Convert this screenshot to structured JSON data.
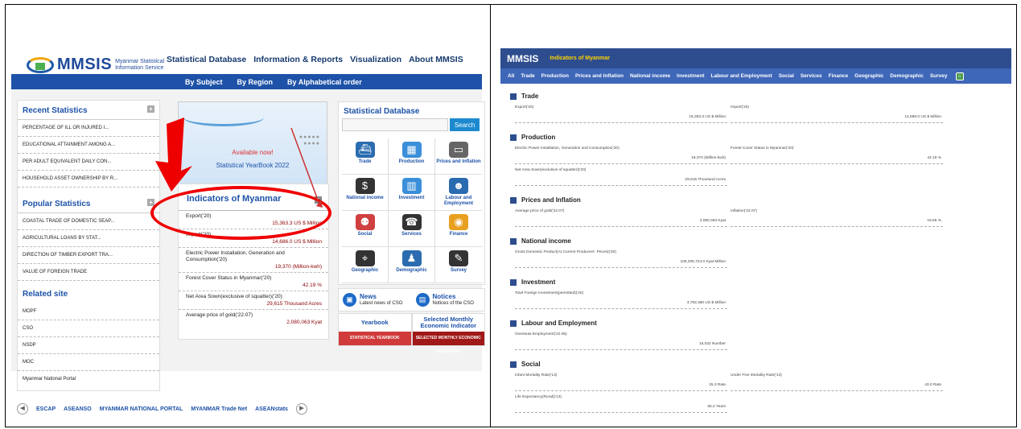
{
  "left": {
    "logo": {
      "name": "MMSIS",
      "sub": "Myanmar Statistical Information Service"
    },
    "topnav": [
      "Statistical Database",
      "Information & Reports",
      "Visualization",
      "About MMSIS"
    ],
    "subnav": [
      "By Subject",
      "By Region",
      "By Alphabetical order"
    ],
    "recent": {
      "title": "Recent Statistics",
      "items": [
        "PERCENTAGE OF ILL OR INJURED I...",
        "EDUCATIONAL ATTAINMENT AMONG A...",
        "PER ADULT EQUIVALENT DAILY CON...",
        "HOUSEHOLD ASSET OWNERSHIP BY R..."
      ]
    },
    "popular": {
      "title": "Popular Statistics",
      "items": [
        "COASTAL TRADE OF DOMESTIC SEAP...",
        "AGRICULTURAL LOANS BY STAT...",
        "DIRECTION OF TIMBER EXPORT TRA...",
        "VALUE OF FOREIGN TRADE"
      ]
    },
    "related": {
      "title": "Related site",
      "items": [
        "MOPF",
        "CSO",
        "NSDP",
        "MOC",
        "Myanmar National Portal"
      ]
    },
    "banner": {
      "available": "Available now!",
      "yearbook": "Statistical YearBook 2022"
    },
    "indicators": {
      "title": "Indicators of Myanmar",
      "rows": [
        {
          "label": "Export('20)",
          "value": "15,363.3 US $ Million"
        },
        {
          "label": "Import('20)",
          "value": "14,686.0 US $ Million"
        },
        {
          "label": "Electric Power Installation, Generation and Consumption('20)",
          "value": "19,370 (Million-kwh)"
        },
        {
          "label": "Forest Cover Status in Myanmar('20)",
          "value": "42.19 %"
        },
        {
          "label": "Net Area Sown(exclusive of squatter)('20)",
          "value": "29,615 Thousand Acres"
        },
        {
          "label": "Average price of gold('22.07)",
          "value": "2,080,063 Kyat"
        }
      ]
    },
    "statdb": {
      "title": "Statistical Database",
      "search_button": "Search",
      "categories": [
        {
          "label": "Trade",
          "icon": "ship-icon",
          "color": "#2b6cb0"
        },
        {
          "label": "Production",
          "icon": "factory-icon",
          "color": "#3a8fd8"
        },
        {
          "label": "Prices and Inflation",
          "icon": "monitor-icon",
          "color": "#666666"
        },
        {
          "label": "National income",
          "icon": "money-bag-icon",
          "color": "#333333"
        },
        {
          "label": "Investment",
          "icon": "chart-icon",
          "color": "#3a8fd8"
        },
        {
          "label": "Labour and Employment",
          "icon": "workers-icon",
          "color": "#2b6cb0"
        },
        {
          "label": "Social",
          "icon": "people-icon",
          "color": "#d04040"
        },
        {
          "label": "Services",
          "icon": "service-icon",
          "color": "#333333"
        },
        {
          "label": "Finance",
          "icon": "coins-icon",
          "color": "#e8a020"
        },
        {
          "label": "Geographic",
          "icon": "map-pin-icon",
          "color": "#333333"
        },
        {
          "label": "Demographic",
          "icon": "population-icon",
          "color": "#2b6cb0"
        },
        {
          "label": "Survey",
          "icon": "clipboard-icon",
          "color": "#333333"
        }
      ]
    },
    "news": {
      "title": "News",
      "desc": "Latest news of CSO"
    },
    "notices": {
      "title": "Notices",
      "desc": "Notices of the CSO"
    },
    "yearbook_tab": {
      "title": "Yearbook",
      "bar": "STATISTICAL YEARBOOK",
      "color": "#d03a3a"
    },
    "monthly_tab": {
      "title": "Selected Monthly Economic Indicator",
      "bar": "SELECTED MONTHLY ECONOMIC INDICATORS",
      "color": "#a01818"
    },
    "partners": [
      "ESCAP",
      "ASEANSO",
      "MYANMAR NATIONAL PORTAL",
      "MYANMAR Trade Net",
      "ASEANstats"
    ]
  },
  "right": {
    "logo": "MMSIS",
    "title": "Indicators of Myanmar",
    "nav": [
      "All",
      "Trade",
      "Production",
      "Prices and Inflation",
      "National income",
      "Investment",
      "Labour and Employment",
      "Social",
      "Services",
      "Finance",
      "Geographic",
      "Demographic",
      "Survey"
    ],
    "sections": [
      {
        "title": "Trade",
        "items": [
          {
            "label": "Export('20)",
            "value": "15,363.3 US $ Million"
          },
          {
            "label": "Import('20)",
            "value": "14,686.0 US $ Million"
          }
        ]
      },
      {
        "title": "Production",
        "items": [
          {
            "label": "Electric Power Installation, Generation and Consumption('20)",
            "value": "19,370 (Million-kwh)"
          },
          {
            "label": "Forest Cover Status in Myanmar('20)",
            "value": "42.19 %"
          },
          {
            "label": "Net Area Sown(exclusive of squatter)('20)",
            "value": "29,615 Thousand Acres"
          }
        ]
      },
      {
        "title": "Prices and Inflation",
        "items": [
          {
            "label": "Average price of gold('22.07)",
            "value": "2,080,063 Kyat"
          },
          {
            "label": "Inflation('22.07)",
            "value": "19.55 %"
          }
        ]
      },
      {
        "title": "National income",
        "items": [
          {
            "label": "Gross Domestic Product(At Current Producers` Prices)('20)",
            "value": "108,205,724.0 Kyat Million"
          }
        ]
      },
      {
        "title": "Investment",
        "items": [
          {
            "label": "Total Foreign Investment(permitted)('20)",
            "value": "3,792,480 US $ Million"
          }
        ]
      },
      {
        "title": "Labour and Employment",
        "items": [
          {
            "label": "Overseas Employment('22.06)",
            "value": "15,032 Number"
          }
        ]
      },
      {
        "title": "Social",
        "items": [
          {
            "label": "Infant Mortality Rate('13)",
            "value": "25.3 Rate"
          },
          {
            "label": "Under Five Mortality Rate('13)",
            "value": "43.0 Rate"
          },
          {
            "label": "Life Expectancy(Rural)('13)",
            "value": "65.2 Years"
          }
        ]
      }
    ]
  }
}
